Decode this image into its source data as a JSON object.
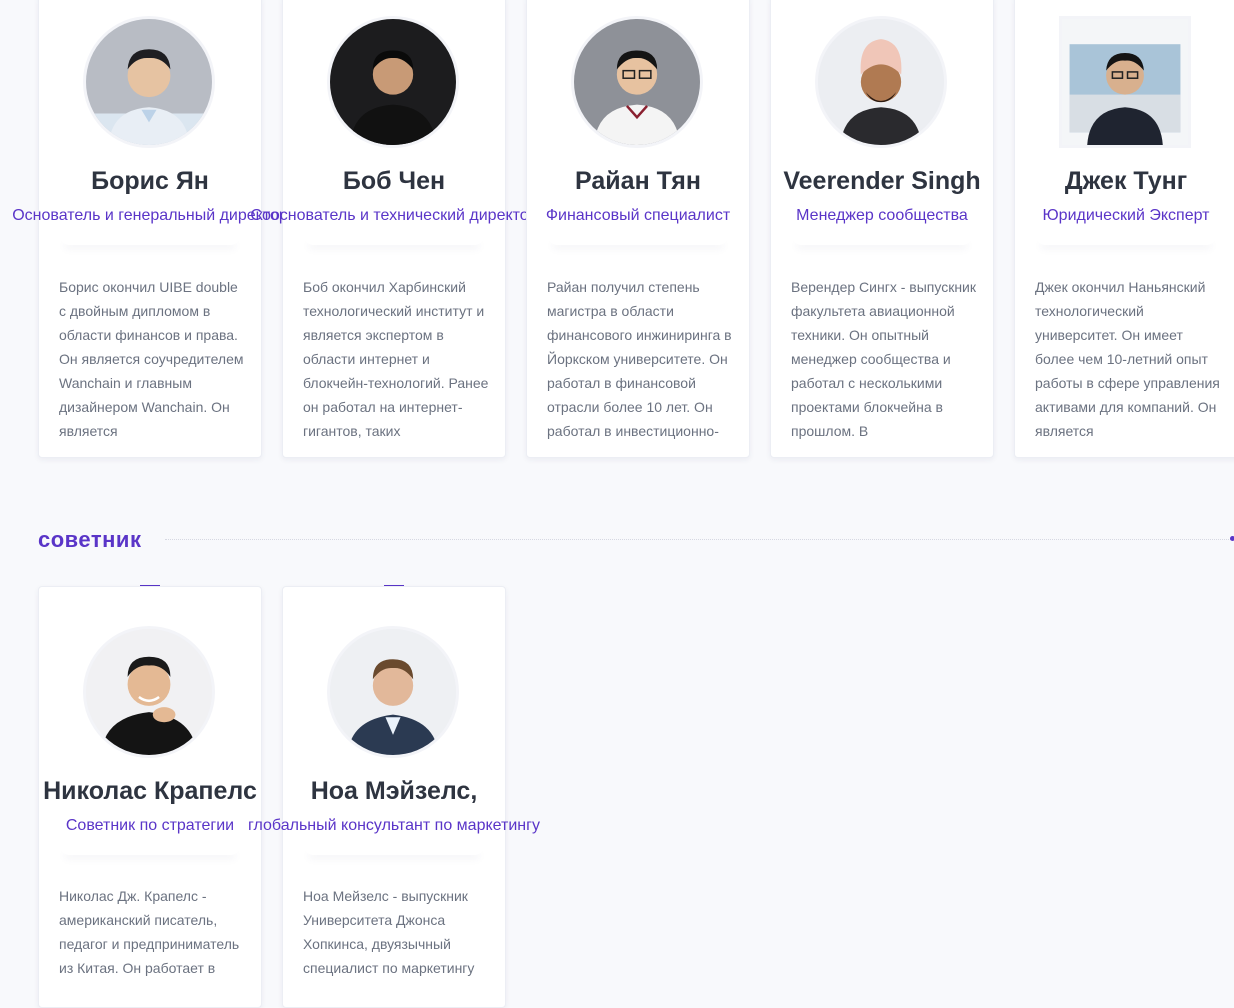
{
  "team": [
    {
      "name": "Борис Ян",
      "role": "Основатель и генеральный директор",
      "bio": "Борис окончил UIBE double с двойным дипломом в области финансов и права. Он является соучредителем Wanchain и главным дизайнером Wanchain. Он является"
    },
    {
      "name": "Боб Чен",
      "role": "Сооснователь и технический директор",
      "bio": "Боб окончил Харбинский технологический институт и является экспертом в области интернет и блокчейн-технологий. Ранее он работал на интернет-гигантов, таких"
    },
    {
      "name": "Райан Тян",
      "role": "Финансовый специалист",
      "bio": "Райан получил степень магистра в области финансового инжиниринга в Йоркском университете. Он работал в финансовой отрасли более 10 лет. Он работал в инвестиционно-"
    },
    {
      "name": "Veerender Singh",
      "role": "Менеджер сообщества",
      "bio": "Верендер Сингх - выпускник факультета авиационной техники. Он опытный менеджер сообщества и работал с несколькими проектами блокчейна в прошлом. В"
    },
    {
      "name": "Джек Тунг",
      "role": "Юридический Эксперт",
      "bio": "Джек окончил Наньянский технологический университет. Он имеет более чем 10-летний опыт работы в сфере управления активами для компаний. Он является"
    }
  ],
  "advisor_section": {
    "title": "советник"
  },
  "advisors": [
    {
      "name": "Николас Крапелс",
      "role": "Советник по стратегии",
      "bio": "Николас Дж. Крапелс - американский писатель, педагог и предприниматель из Китая. Он работает в"
    },
    {
      "name": "Ноа Мэйзелс,",
      "role": "глобальный консультант по маркетингу",
      "bio": "Ноа Мейзелс - выпускник Университета Джонса Хопкинса, двуязычный специалист по маркетингу"
    }
  ],
  "colors": {
    "accent": "#5a35c8",
    "heading": "#2e3440",
    "text": "#6b7280",
    "background": "#f8f9fc"
  }
}
